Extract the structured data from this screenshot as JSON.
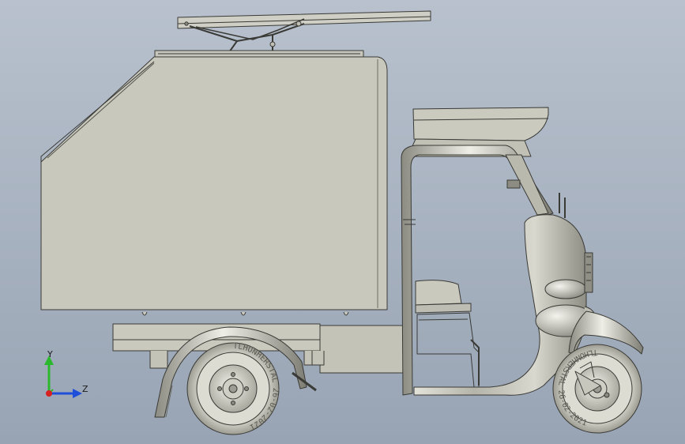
{
  "viewport": {
    "background_top": "#b7c0cc",
    "background_bottom": "#9aa6b5",
    "model_color": "#c8c8bd",
    "line_color": "#3a3a36"
  },
  "model": {
    "tire_text": "TLHONHERSTAL 26-02-2021"
  },
  "triad": {
    "x_label": "",
    "y_label": "Y",
    "z_label": "Z",
    "y_color": "#2cb82c",
    "z_color": "#1f4fd9",
    "x_color": "#d92020"
  }
}
